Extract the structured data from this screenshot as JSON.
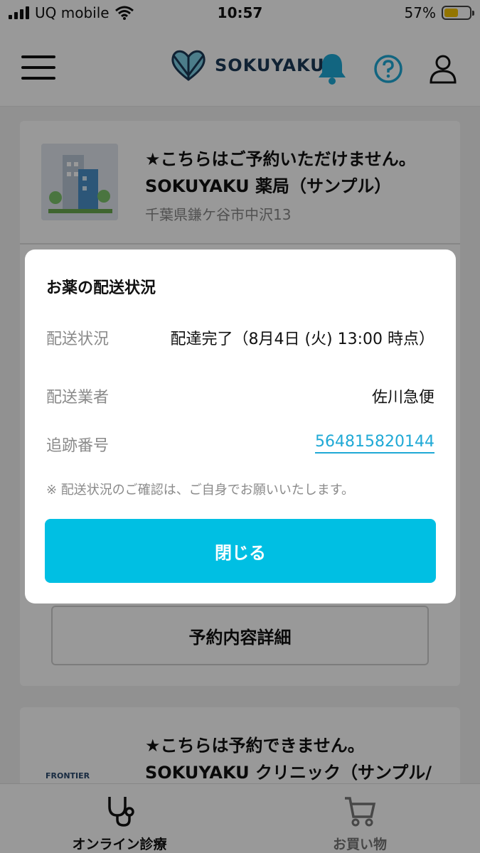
{
  "status_bar": {
    "carrier": "UQ mobile",
    "time": "10:57",
    "battery": "57%",
    "battery_level": 0.57
  },
  "header": {
    "logo_text": "SOKUYAKU",
    "icons": [
      "menu-icon",
      "bell-icon",
      "help-icon",
      "user-icon"
    ]
  },
  "cards": [
    {
      "title_line1": "★こちらはご予約いただけません。",
      "title_line2": "SOKUYAKU 薬局（サンプル）",
      "address": "千葉県鎌ケ谷市中沢13",
      "detail_button": "予約内容詳細"
    },
    {
      "title_line1": "★こちらは予約できません。",
      "title_line2": "SOKUYAKU クリニック（サンプル/",
      "logo_text": "FRONTIER"
    }
  ],
  "modal": {
    "title": "お薬の配送状況",
    "rows": [
      {
        "label": "配送状況",
        "value": "配達完了（8月4日 (火) 13:00 時点）"
      },
      {
        "label": "配送業者",
        "value": "佐川急便"
      },
      {
        "label": "追跡番号",
        "value": "564815820144"
      }
    ],
    "note": "※ 配送状況のご確認は、ご自身でお願いいたします。",
    "close_button": "閉じる"
  },
  "tabbar": {
    "items": [
      {
        "label": "オンライン診療",
        "icon": "stethoscope-icon"
      },
      {
        "label": "お買い物",
        "icon": "cart-icon"
      }
    ]
  },
  "colors": {
    "accent": "#00bfe3",
    "link": "#1fa9d6",
    "logo": "#1b3a57",
    "battery": "#f5c400"
  }
}
